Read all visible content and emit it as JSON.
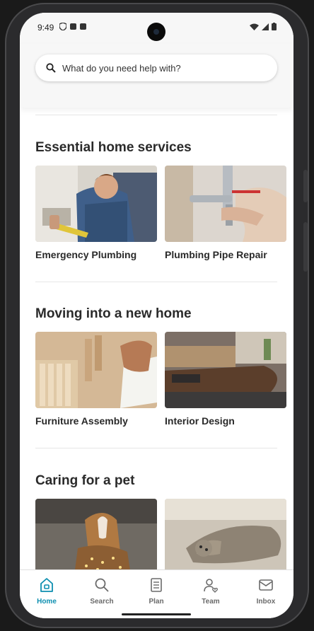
{
  "status": {
    "time": "9:49"
  },
  "search": {
    "placeholder": "What do you need help with?"
  },
  "sections": [
    {
      "title": "Essential home services",
      "cards": [
        {
          "label": "Emergency Plumbing"
        },
        {
          "label": "Plumbing Pipe Repair"
        }
      ]
    },
    {
      "title": "Moving into a new home",
      "cards": [
        {
          "label": "Furniture Assembly"
        },
        {
          "label": "Interior Design"
        }
      ]
    },
    {
      "title": "Caring for a pet",
      "cards": [
        {
          "label": ""
        },
        {
          "label": ""
        }
      ]
    }
  ],
  "tabs": [
    {
      "label": "Home",
      "icon": "home-icon",
      "active": true
    },
    {
      "label": "Search",
      "icon": "search-icon"
    },
    {
      "label": "Plan",
      "icon": "plan-icon"
    },
    {
      "label": "Team",
      "icon": "team-icon"
    },
    {
      "label": "Inbox",
      "icon": "inbox-icon"
    }
  ],
  "colors": {
    "accent": "#0d8fb0",
    "text": "#2a2a2a"
  }
}
